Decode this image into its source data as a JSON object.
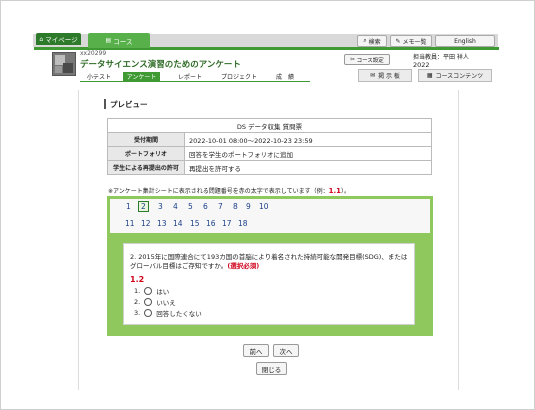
{
  "topbar": {
    "mypage_tab": "マイページ",
    "course_tab": "コース",
    "search_btn": "検索",
    "memo_btn": "メモ一覧",
    "lang_btn": "English"
  },
  "course": {
    "code": "xx20299",
    "title": "データサイエンス演習のためのアンケート",
    "settings_btn": "コース設定",
    "teacher": "担当教員：平田 祥人",
    "year": "2022"
  },
  "subnav": [
    "小テスト",
    "アンケート",
    "レポート",
    "プロジェクト",
    "成　績"
  ],
  "rightnav": {
    "board": "掲 示 板",
    "contents": "コースコンテンツ"
  },
  "preview": {
    "heading": "プレビュー",
    "table_title": "DS データ収集 質問票",
    "rows": [
      {
        "label": "受付期間",
        "value": "2022-10-01 08:00～2022-10-23 23:59"
      },
      {
        "label": "ポートフォリオ",
        "value": "回答を学生のポートフォリオに追加"
      },
      {
        "label": "学生による再提出の許可",
        "value": "再提出を許可する"
      }
    ],
    "note": "※アンケート集計シートに表示される問題番号を赤の太字で表示しています（例：",
    "note_example": "1.1",
    "note_end": "）。"
  },
  "question_numbers": [
    "1",
    "2",
    "3",
    "4",
    "5",
    "6",
    "7",
    "8",
    "9",
    "10",
    "11",
    "12",
    "13",
    "14",
    "15",
    "16",
    "17",
    "18"
  ],
  "current_question": "2",
  "question": {
    "text": "2. 2015年に国際連合にて193カ国の首脳により着名された持続可能な開発目標(SDG)、またはグローバル目標はご存知ですか。",
    "required": "(選択必須)",
    "sheet_number": "1.2",
    "options": [
      {
        "num": "1.",
        "label": "はい"
      },
      {
        "num": "2.",
        "label": "いいえ"
      },
      {
        "num": "3.",
        "label": "回答したくない"
      }
    ]
  },
  "buttons": {
    "prev": "前へ",
    "next": "次へ",
    "close": "閉じる"
  },
  "colors": {
    "accent": "#3f9a34",
    "required": "#d0021b"
  }
}
